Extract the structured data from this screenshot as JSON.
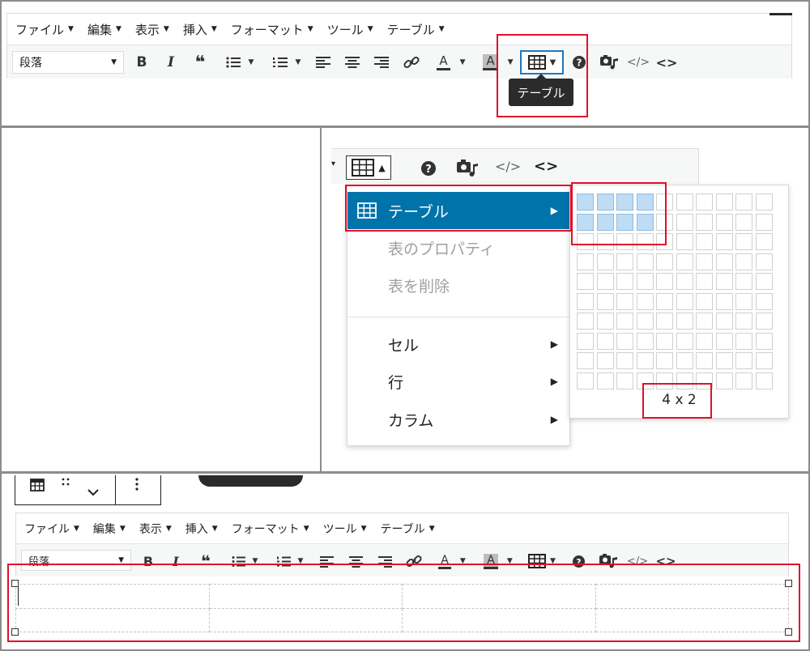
{
  "menubar": {
    "items": [
      {
        "label": "ファイル"
      },
      {
        "label": "編集"
      },
      {
        "label": "表示"
      },
      {
        "label": "挿入"
      },
      {
        "label": "フォーマット"
      },
      {
        "label": "ツール"
      },
      {
        "label": "テーブル"
      }
    ]
  },
  "toolbar": {
    "format_select": "段落",
    "bold": "B",
    "italic": "I",
    "quote": "❝",
    "text_color": "A",
    "bg_color": "A",
    "source": "</>",
    "code": "<>"
  },
  "tooltip": {
    "text": "テーブル"
  },
  "table_menu": {
    "items": [
      {
        "label": "テーブル"
      },
      {
        "label": "表のプロパティ"
      },
      {
        "label": "表を削除"
      },
      {
        "label": "セル"
      },
      {
        "label": "行"
      },
      {
        "label": "カラム"
      }
    ]
  },
  "grid_picker": {
    "label": "4 x 2",
    "selected_cols": 4,
    "selected_rows": 2
  },
  "colors": {
    "accent": "#0073aa",
    "highlight": "#e0102a",
    "selection": "#bfdcf5"
  }
}
